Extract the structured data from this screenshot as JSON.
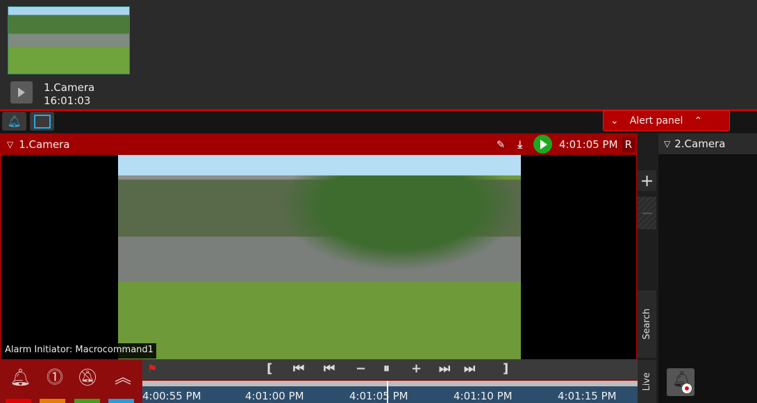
{
  "thumbnail": {
    "camera": "1.Camera",
    "time": "16:01:03"
  },
  "alert_panel": {
    "label": "Alert panel"
  },
  "camera1": {
    "title": "1.Camera",
    "time": "4:01:05 PM",
    "mode": "R",
    "alarm_initiator": "Alarm Initiator: Macrocommand1"
  },
  "timeline": {
    "labels": [
      "4:00:55 PM",
      "4:01:00 PM",
      "4:01:05 PM",
      "4:01:10 PM",
      "4:01:15 PM"
    ]
  },
  "side": {
    "search": "Search",
    "live": "Live",
    "plus": "+"
  },
  "camera2": {
    "title": "2.Camera"
  },
  "colors": {
    "accent": "#a00000",
    "timeline": "#2d4d6c",
    "play": "#1ea81e"
  }
}
